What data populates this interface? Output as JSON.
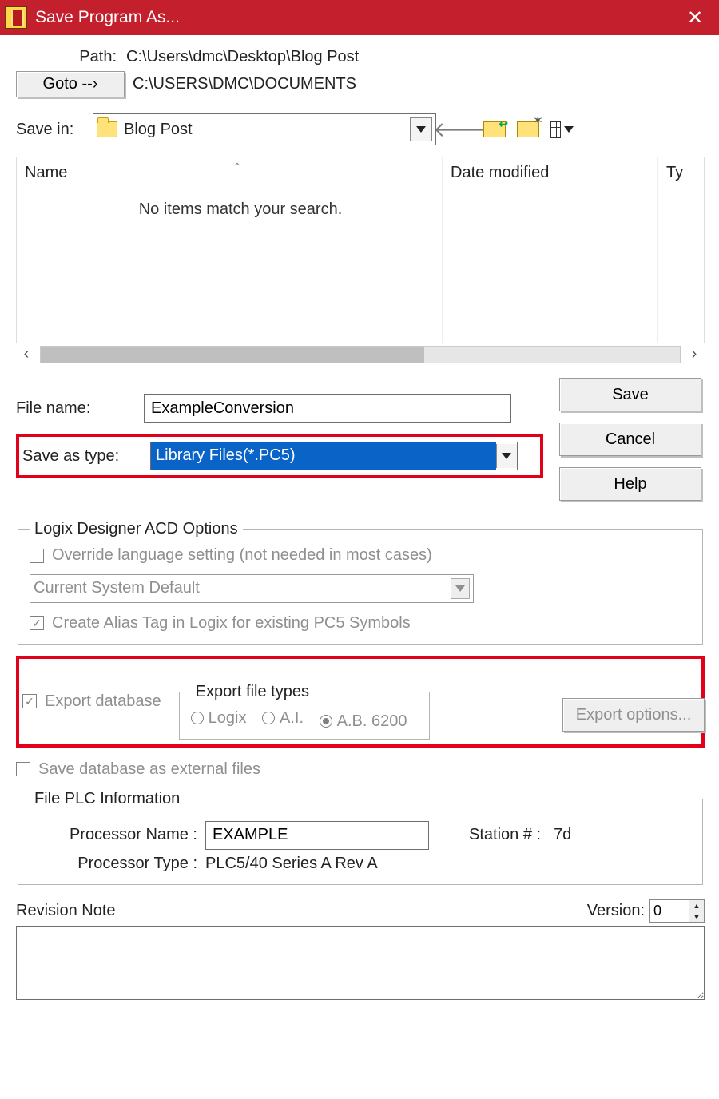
{
  "titlebar": {
    "title": "Save Program As..."
  },
  "path": {
    "label": "Path:",
    "value": "C:\\Users\\dmc\\Desktop\\Blog Post"
  },
  "goto": {
    "button": "Goto  --›",
    "value": "C:\\USERS\\DMC\\DOCUMENTS"
  },
  "savein": {
    "label": "Save in:",
    "folder": "Blog Post"
  },
  "columns": {
    "name": "Name",
    "date": "Date modified",
    "type": "Ty"
  },
  "empty_message": "No items match your search.",
  "filename": {
    "label": "File name:",
    "value": "ExampleConversion"
  },
  "saveas": {
    "label": "Save as type:",
    "value": "Library Files(*.PC5)"
  },
  "buttons": {
    "save": "Save",
    "cancel": "Cancel",
    "help": "Help",
    "export_options": "Export options..."
  },
  "acd": {
    "legend": "Logix Designer ACD Options",
    "override": "Override language setting (not needed in most cases)",
    "lang_default": "Current System Default",
    "create_alias": "Create Alias Tag in Logix for existing PC5 Symbols"
  },
  "export": {
    "database": "Export database",
    "file_types_legend": "Export file types",
    "logix": "Logix",
    "ai": "A.I.",
    "ab6200": "A.B. 6200",
    "save_external": "Save database as external files"
  },
  "plc": {
    "legend": "File PLC Information",
    "proc_name_label": "Processor Name :",
    "proc_name": "EXAMPLE",
    "station_label": "Station # :",
    "station": "7d",
    "proc_type_label": "Processor Type :",
    "proc_type": "PLC5/40 Series A  Rev A"
  },
  "revision": {
    "label": "Revision Note",
    "version_label": "Version:",
    "version": "0"
  }
}
